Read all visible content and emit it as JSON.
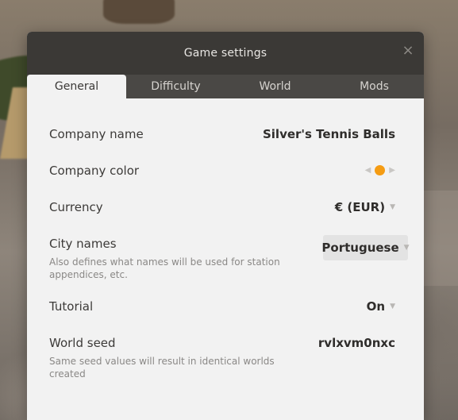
{
  "dialog": {
    "title": "Game settings",
    "close_icon": "×"
  },
  "tabs": [
    {
      "label": "General",
      "active": true
    },
    {
      "label": "Difficulty",
      "active": false
    },
    {
      "label": "World",
      "active": false
    },
    {
      "label": "Mods",
      "active": false
    }
  ],
  "settings": {
    "company_name": {
      "label": "Company name",
      "value": "Silver's Tennis Balls"
    },
    "company_color": {
      "label": "Company color",
      "color": "#f59c13"
    },
    "currency": {
      "label": "Currency",
      "value": "€ (EUR)"
    },
    "city_names": {
      "label": "City names",
      "value": "Portuguese",
      "hint": "Also defines what names will be used for station appendices, etc."
    },
    "tutorial": {
      "label": "Tutorial",
      "value": "On"
    },
    "world_seed": {
      "label": "World seed",
      "value": "rvlxvm0nxc",
      "hint": "Same seed values will result in identical worlds created"
    }
  },
  "icons": {
    "close": "close-icon",
    "caret": "chevron-down-icon",
    "left": "arrow-left-icon",
    "right": "arrow-right-icon"
  }
}
